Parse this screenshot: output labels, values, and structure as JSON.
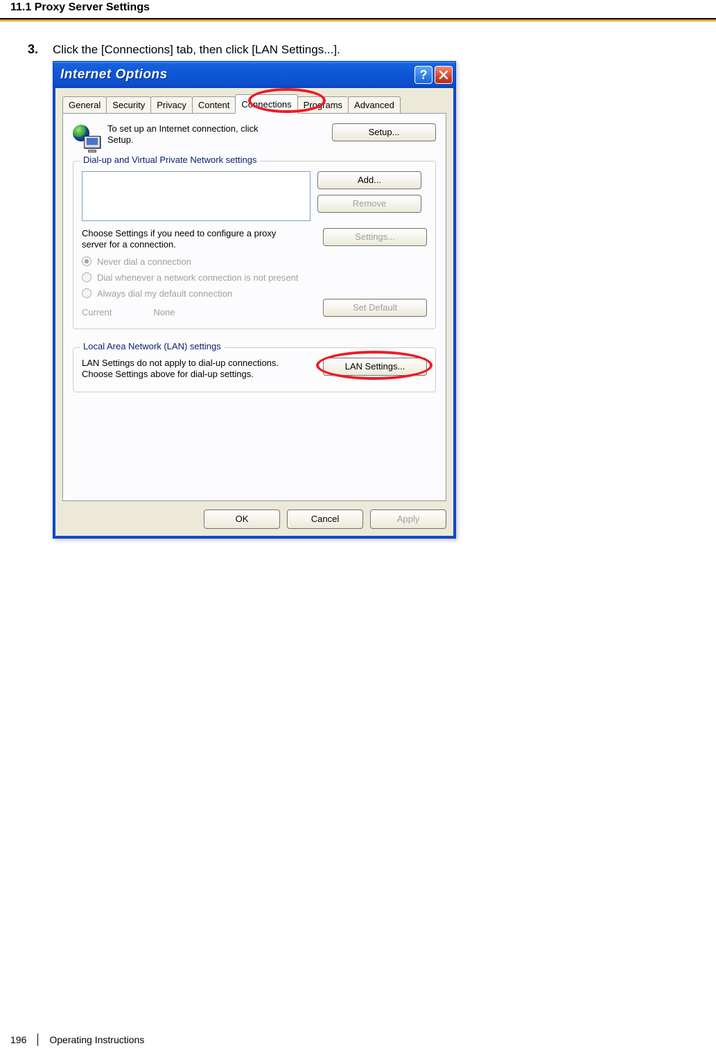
{
  "page": {
    "section_number_title": "11.1 Proxy Server Settings",
    "footer_page_number": "196",
    "footer_doc_title": "Operating Instructions"
  },
  "step": {
    "number": "3.",
    "text": "Click the [Connections] tab, then click [LAN Settings...]."
  },
  "dialog": {
    "title": "Internet Options",
    "tabs": {
      "general": "General",
      "security": "Security",
      "privacy": "Privacy",
      "content": "Content",
      "connections": "Connections",
      "programs": "Programs",
      "advanced": "Advanced"
    },
    "setup": {
      "text_line1": "To set up an Internet connection, click",
      "text_line2": "Setup.",
      "button": "Setup..."
    },
    "dialup_group": {
      "title": "Dial-up and Virtual Private Network settings",
      "add_button": "Add...",
      "remove_button": "Remove",
      "settings_button": "Settings...",
      "choose_text_l1": "Choose Settings if you need to configure a proxy",
      "choose_text_l2": "server for a connection.",
      "radio_never": "Never dial a connection",
      "radio_whenever": "Dial whenever a network connection is not present",
      "radio_always": "Always dial my default connection",
      "current_label": "Current",
      "current_value": "None",
      "set_default_button": "Set Default"
    },
    "lan_group": {
      "title": "Local Area Network (LAN) settings",
      "text_l1": "LAN Settings do not apply to dial-up connections.",
      "text_l2": "Choose Settings above for dial-up settings.",
      "button": "LAN Settings..."
    },
    "footer_buttons": {
      "ok": "OK",
      "cancel": "Cancel",
      "apply": "Apply"
    }
  }
}
